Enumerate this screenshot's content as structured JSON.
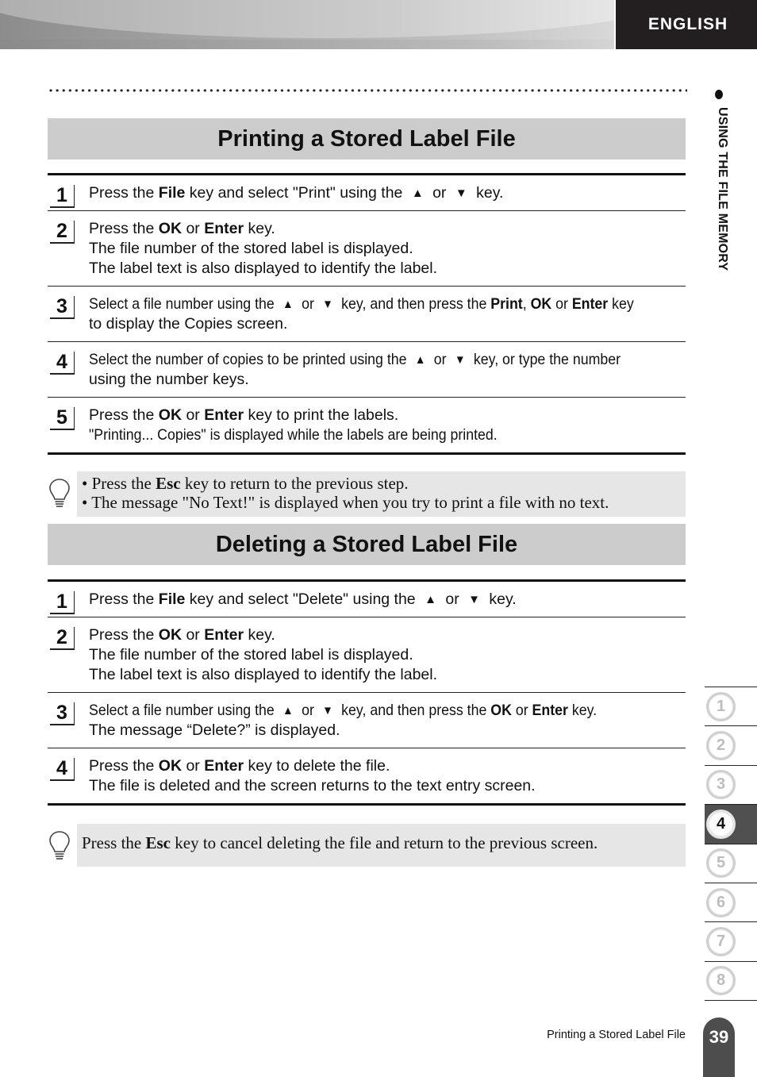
{
  "header": {
    "language_tab": "ENGLISH"
  },
  "side_chapter_title": "USING THE FILE MEMORY",
  "sections": [
    {
      "title": "Printing a Stored Label File",
      "steps": [
        {
          "number": "1",
          "lines": [
            {
              "parts": [
                "Press the ",
                {
                  "b": "File"
                },
                " key  and select \"Print\" using the ",
                {
                  "icon": "up"
                },
                " or ",
                {
                  "icon": "down"
                },
                " key."
              ]
            }
          ]
        },
        {
          "number": "2",
          "lines": [
            {
              "parts": [
                "Press the ",
                {
                  "b": "OK"
                },
                " or ",
                {
                  "b": "Enter"
                },
                " key."
              ]
            },
            {
              "parts": [
                "The file number of the stored label is displayed."
              ]
            },
            {
              "parts": [
                "The label text is also displayed to identify the label."
              ]
            }
          ]
        },
        {
          "number": "3",
          "lines": [
            {
              "parts": [
                "Select a file number using the ",
                {
                  "icon": "up"
                },
                " or ",
                {
                  "icon": "down"
                },
                " key, and then press the ",
                {
                  "b": "Print"
                },
                ", ",
                {
                  "b": "OK"
                },
                " or ",
                {
                  "b": "Enter"
                },
                " key"
              ]
            },
            {
              "parts": [
                "to display the Copies screen."
              ]
            }
          ]
        },
        {
          "number": "4",
          "lines": [
            {
              "parts": [
                "Select the number of copies to be printed using the ",
                {
                  "icon": "up"
                },
                " or ",
                {
                  "icon": "down"
                },
                " key, or type the number"
              ]
            },
            {
              "parts": [
                "using the number keys."
              ]
            }
          ]
        },
        {
          "number": "5",
          "lines": [
            {
              "parts": [
                "Press the ",
                {
                  "b": "OK"
                },
                " or ",
                {
                  "b": "Enter"
                },
                " key to print the labels."
              ]
            },
            {
              "parts": [
                "\"Printing... Copies\" is displayed while the labels are being printed."
              ]
            }
          ]
        }
      ],
      "tip": [
        {
          "parts": [
            "• Press the ",
            {
              "b": "Esc"
            },
            " key to return to the previous step."
          ]
        },
        {
          "parts": [
            "• The message \"No Text!\" is displayed when you try to print a file with no text."
          ]
        }
      ]
    },
    {
      "title": "Deleting a Stored Label File",
      "steps": [
        {
          "number": "1",
          "lines": [
            {
              "parts": [
                "Press the ",
                {
                  "b": "File"
                },
                " key  and select \"Delete\" using the ",
                {
                  "icon": "up"
                },
                " or ",
                {
                  "icon": "down"
                },
                " key."
              ]
            }
          ]
        },
        {
          "number": "2",
          "lines": [
            {
              "parts": [
                "Press the ",
                {
                  "b": "OK"
                },
                " or ",
                {
                  "b": "Enter"
                },
                " key."
              ]
            },
            {
              "parts": [
                "The file number of the stored label is displayed."
              ]
            },
            {
              "parts": [
                "The label text is also displayed to identify the label."
              ]
            }
          ]
        },
        {
          "number": "3",
          "lines": [
            {
              "parts": [
                "Select a file number using the ",
                {
                  "icon": "up"
                },
                " or ",
                {
                  "icon": "down"
                },
                " key, and then press the ",
                {
                  "b": "OK"
                },
                " or ",
                {
                  "b": "Enter"
                },
                " key."
              ]
            },
            {
              "parts": [
                "The message “Delete?” is displayed."
              ]
            }
          ]
        },
        {
          "number": "4",
          "lines": [
            {
              "parts": [
                "Press the ",
                {
                  "b": "OK"
                },
                " or ",
                {
                  "b": "Enter"
                },
                " key to delete the file."
              ]
            },
            {
              "parts": [
                "The file is deleted and the screen returns to the text entry screen."
              ]
            }
          ]
        }
      ],
      "tip": [
        {
          "parts": [
            "Press the ",
            {
              "b": "Esc"
            },
            " key to cancel deleting the file and return to the previous screen."
          ]
        }
      ]
    }
  ],
  "icons": {
    "up": "▲",
    "down": "▼"
  },
  "chapter_tabs": [
    "1",
    "2",
    "3",
    "4",
    "5",
    "6",
    "7",
    "8"
  ],
  "active_chapter": "4",
  "footer": {
    "section_title": "Printing a Stored Label File",
    "page_number": "39"
  }
}
